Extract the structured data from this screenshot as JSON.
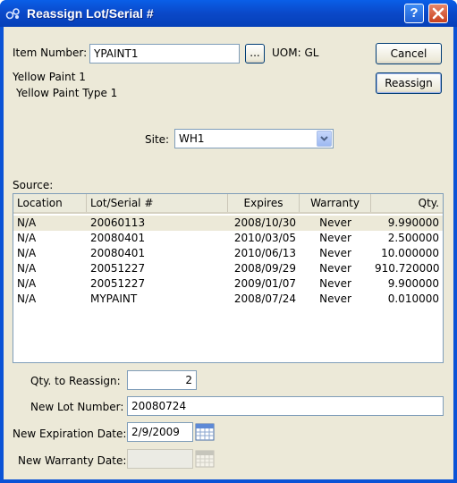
{
  "window": {
    "title": "Reassign Lot/Serial #"
  },
  "item": {
    "label": "Item Number:",
    "value": "YPAINT1",
    "lookup_label": "...",
    "uom_text": "UOM: GL",
    "desc1": "Yellow Paint 1",
    "desc2": "Yellow Paint Type 1"
  },
  "buttons": {
    "cancel": "Cancel",
    "reassign": "Reassign"
  },
  "site": {
    "label": "Site:",
    "value": "WH1"
  },
  "source": {
    "label": "Source:",
    "columns": [
      "Location",
      "Lot/Serial #",
      "Expires",
      "Warranty",
      "Qty."
    ],
    "rows": [
      [
        "N/A",
        "20060113",
        "2008/10/30",
        "Never",
        "9.990000"
      ],
      [
        "N/A",
        "20080401",
        "2010/03/05",
        "Never",
        "2.500000"
      ],
      [
        "N/A",
        "20080401",
        "2010/06/13",
        "Never",
        "10.000000"
      ],
      [
        "N/A",
        "20051227",
        "2008/09/29",
        "Never",
        "910.720000"
      ],
      [
        "N/A",
        "20051227",
        "2009/01/07",
        "Never",
        "9.900000"
      ],
      [
        "N/A",
        "MYPAINT",
        "2008/07/24",
        "Never",
        "0.010000"
      ]
    ]
  },
  "form": {
    "qty_label": "Qty. to Reassign:",
    "qty_value": "2",
    "new_lot_label": "New Lot Number:",
    "new_lot_value": "20080724",
    "new_exp_label": "New Expiration Date:",
    "new_exp_value": "2/9/2009",
    "new_warranty_label": "New Warranty Date:",
    "new_warranty_value": ""
  },
  "colors": {
    "title_bar": "#0a5fe8",
    "dialog_bg": "#ece9d8",
    "selected_row": "#ece9d8"
  },
  "icons": {
    "app": "xtuple-app-icon",
    "help": "help-icon",
    "close": "close-icon",
    "calendar": "calendar-icon",
    "dropdown": "chevron-down-icon"
  }
}
